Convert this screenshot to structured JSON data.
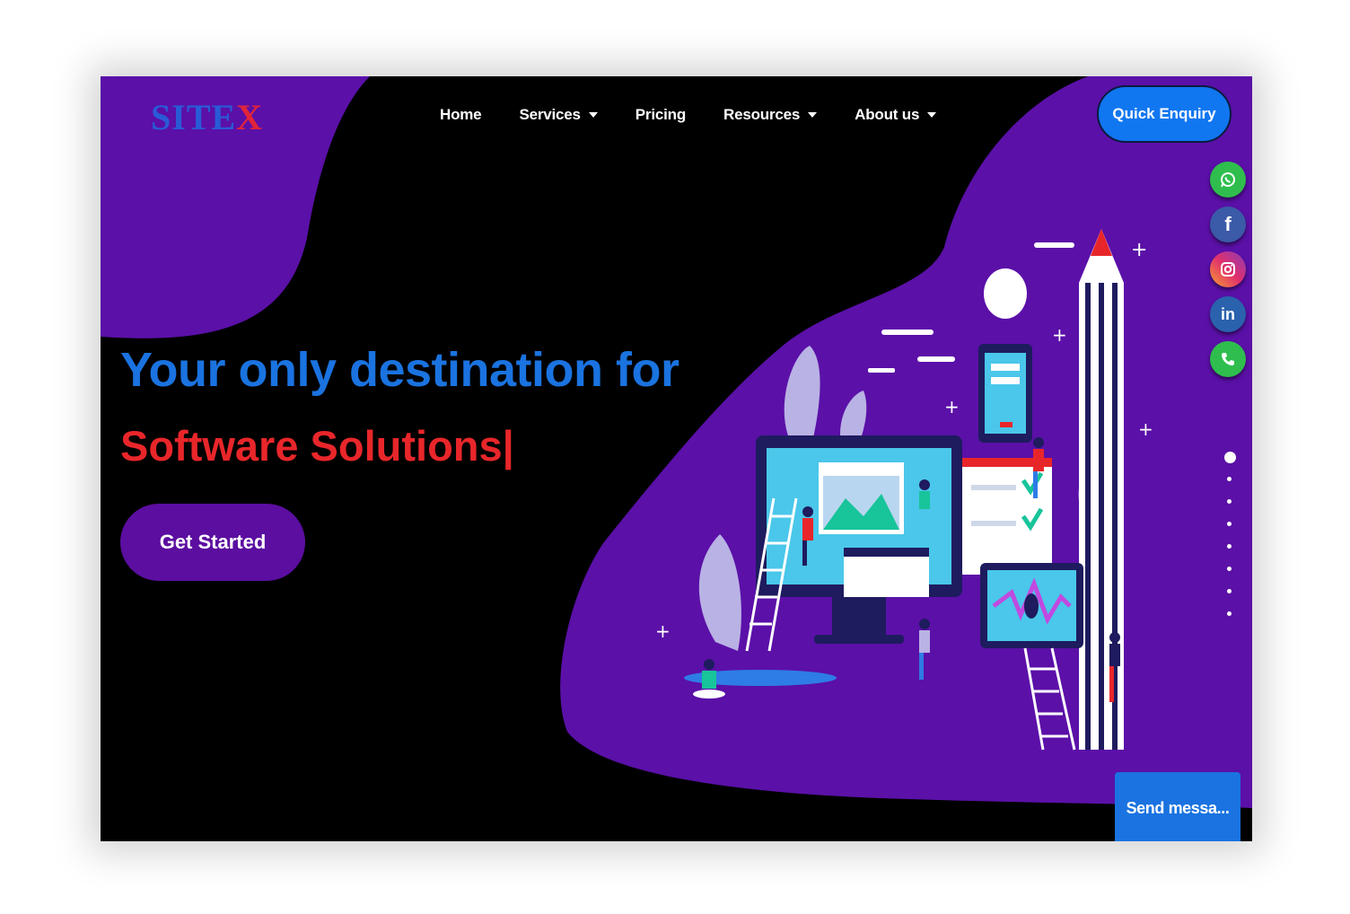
{
  "brand": {
    "logo_text": "SITE",
    "logo_accent": "X",
    "logo_color": "#2a5bd7",
    "accent_color": "#e0243a"
  },
  "nav": {
    "items": [
      {
        "label": "Home",
        "dropdown": false
      },
      {
        "label": "Services",
        "dropdown": true
      },
      {
        "label": "Pricing",
        "dropdown": false
      },
      {
        "label": "Resources",
        "dropdown": true
      },
      {
        "label": "About us",
        "dropdown": true
      }
    ],
    "cta": "Quick Enquiry"
  },
  "social": [
    {
      "name": "whatsapp",
      "icon": "whatsapp-icon",
      "color": "#2fbe4e"
    },
    {
      "name": "facebook",
      "icon": "facebook-icon",
      "color": "#3b5aa8"
    },
    {
      "name": "instagram",
      "icon": "instagram-icon",
      "color": "#e1306c"
    },
    {
      "name": "linkedin",
      "icon": "linkedin-icon",
      "color": "#2a62ad"
    },
    {
      "name": "phone",
      "icon": "phone-icon",
      "color": "#2fbe4e"
    }
  ],
  "hero": {
    "line1": "Your only destination for",
    "line2": "Software Solutions|",
    "cta": "Get Started",
    "line1_color": "#1a73e0",
    "line2_color": "#e8262a",
    "button_color": "#5b0ea0"
  },
  "slider": {
    "total": 8,
    "active_index": 0
  },
  "chat": {
    "label": "Send messa..."
  },
  "colors": {
    "background": "#000000",
    "blob": "#5b10a8"
  }
}
